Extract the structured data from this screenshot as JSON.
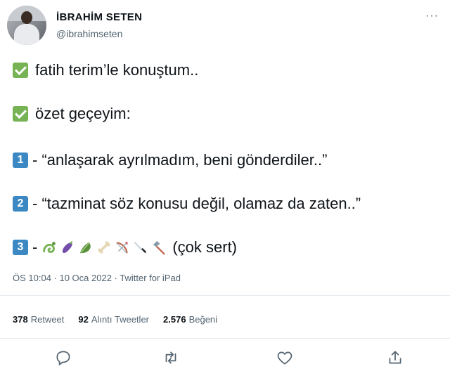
{
  "tweet": {
    "display_name": "İBRAHİM SETEN",
    "handle": "@ibrahimseten",
    "more_label": "···",
    "lines": [
      "fatih terim’le konuştum..",
      "özet geçeyim:",
      "- “anlaşarak ayrılmadım, beni gönderdiler..”",
      "- “tazminat söz konusu değil, olamaz da zaten..”",
      "(çok sert)"
    ],
    "keycaps": [
      "1",
      "2",
      "3"
    ],
    "dash": "-",
    "emojis": [
      "snake-emoji",
      "eggplant-emoji",
      "lettuce-emoji",
      "bone-emoji",
      "bow-and-arrow-emoji",
      "knife-emoji",
      "axe-emoji"
    ],
    "timestamp": "ÖS 10:04 · 10 Oca 2022 · Twitter for iPad"
  },
  "stats": {
    "retweets_count": "378",
    "retweets_label": "Retweet",
    "quotes_count": "92",
    "quotes_label": "Alıntı Tweetler",
    "likes_count": "2.576",
    "likes_label": "Beğeni"
  },
  "actions": [
    "reply-icon",
    "retweet-icon",
    "like-icon",
    "share-icon"
  ],
  "colors": {
    "check_green": "#77b255",
    "keycap_blue": "#3b88c3",
    "secondary_text": "#536471",
    "divider": "#e6ecf0"
  }
}
